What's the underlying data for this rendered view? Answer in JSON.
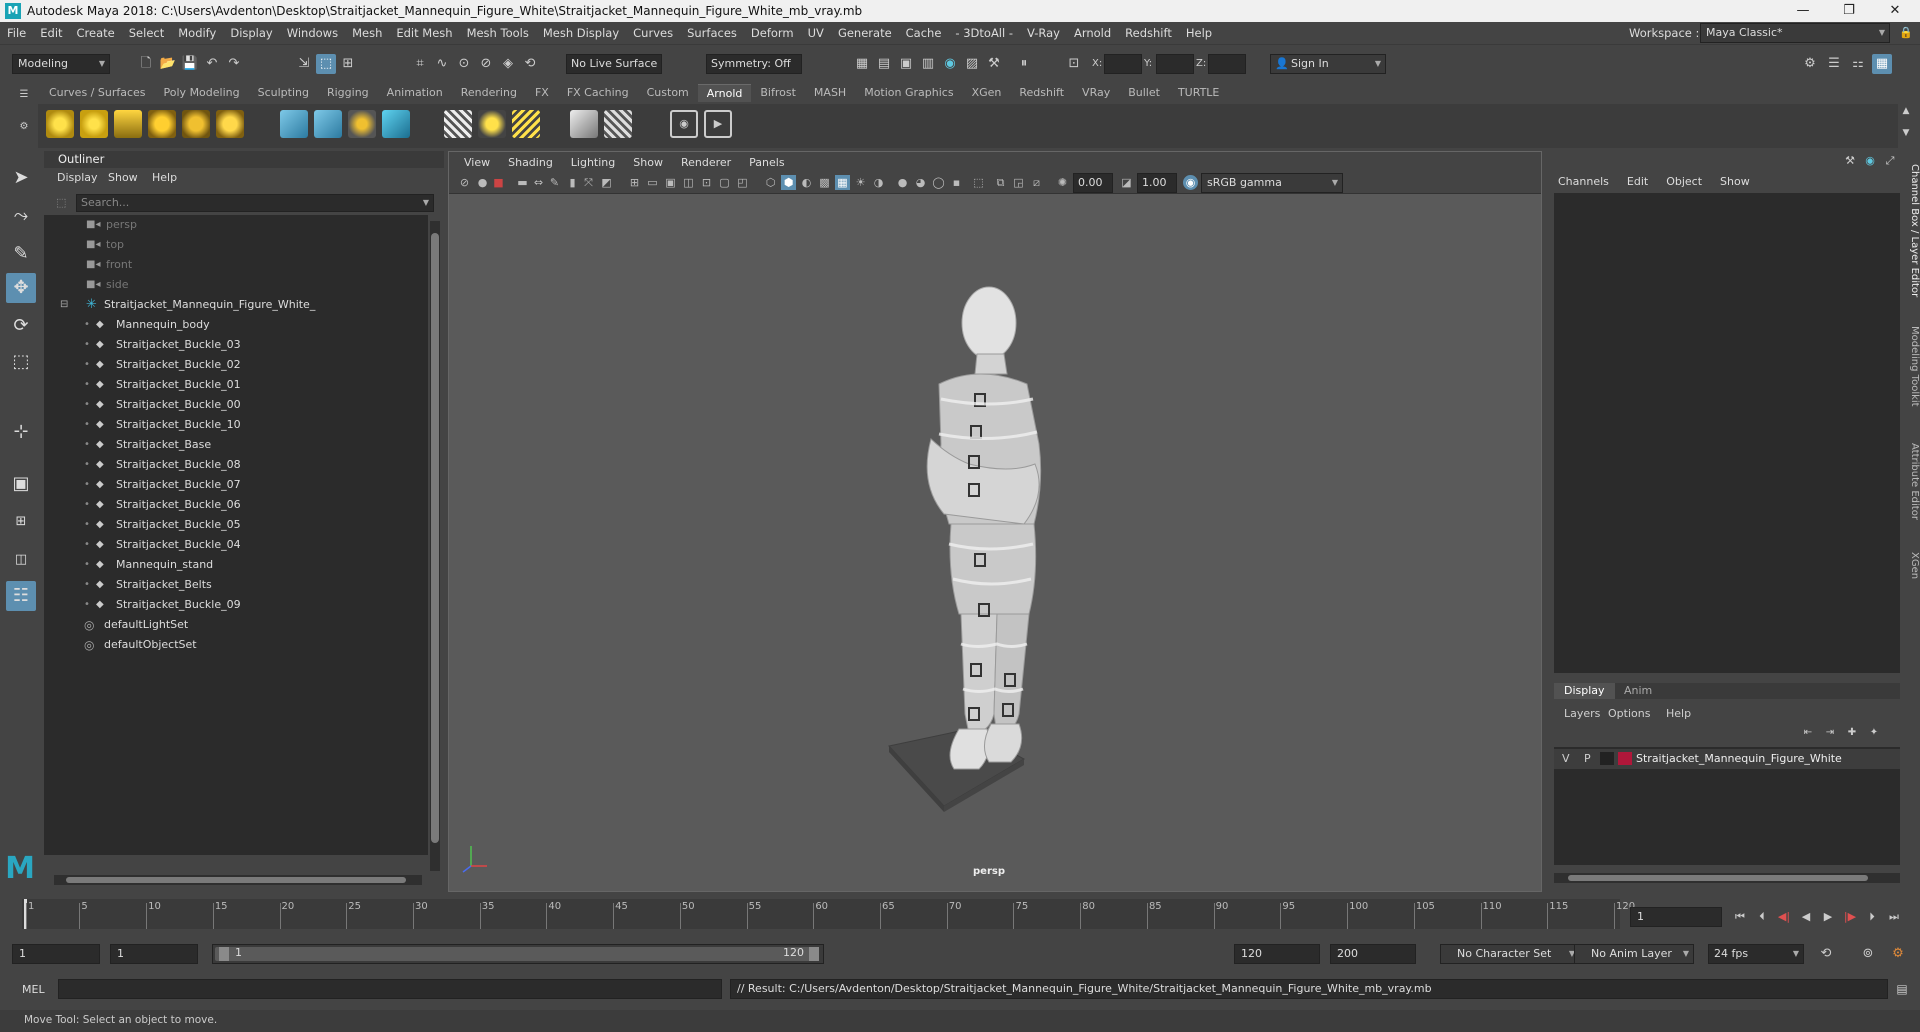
{
  "window": {
    "title": "Autodesk Maya 2018: C:\\Users\\Avdenton\\Desktop\\Straitjacket_Mannequin_Figure_White\\Straitjacket_Mannequin_Figure_White_mb_vray.mb",
    "logo": "M"
  },
  "menu": [
    "File",
    "Edit",
    "Create",
    "Select",
    "Modify",
    "Display",
    "Windows",
    "Mesh",
    "Edit Mesh",
    "Mesh Tools",
    "Mesh Display",
    "Curves",
    "Surfaces",
    "Deform",
    "UV",
    "Generate",
    "Cache",
    "- 3DtoAll -",
    "V-Ray",
    "Arnold",
    "Redshift",
    "Help"
  ],
  "workspace": {
    "label": "Workspace :",
    "value": "Maya Classic*"
  },
  "status": {
    "mode": "Modeling",
    "live_surface": "No Live Surface",
    "symmetry": "Symmetry: Off",
    "x_label": "X:",
    "y_label": "Y:",
    "z_label": "Z:",
    "sign_in": "Sign In"
  },
  "shelf_tabs": [
    "Curves / Surfaces",
    "Poly Modeling",
    "Sculpting",
    "Rigging",
    "Animation",
    "Rendering",
    "FX",
    "FX Caching",
    "Custom",
    "Arnold",
    "Bifrost",
    "MASH",
    "Motion Graphics",
    "XGen",
    "Redshift",
    "VRay",
    "Bullet",
    "TURTLE"
  ],
  "shelf_active": "Arnold",
  "outliner": {
    "title": "Outliner",
    "menu": [
      "Display",
      "Show",
      "Help"
    ],
    "search_placeholder": "Search...",
    "cameras": [
      "persp",
      "top",
      "front",
      "side"
    ],
    "group": "Straitjacket_Mannequin_Figure_White_",
    "children": [
      "Mannequin_body",
      "Straitjacket_Buckle_03",
      "Straitjacket_Buckle_02",
      "Straitjacket_Buckle_01",
      "Straitjacket_Buckle_00",
      "Straitjacket_Buckle_10",
      "Straitjacket_Base",
      "Straitjacket_Buckle_08",
      "Straitjacket_Buckle_07",
      "Straitjacket_Buckle_06",
      "Straitjacket_Buckle_05",
      "Straitjacket_Buckle_04",
      "Mannequin_stand",
      "Straitjacket_Belts",
      "Straitjacket_Buckle_09"
    ],
    "sets": [
      "defaultLightSet",
      "defaultObjectSet"
    ]
  },
  "viewport": {
    "menu": [
      "View",
      "Shading",
      "Lighting",
      "Show",
      "Renderer",
      "Panels"
    ],
    "exposure": "0.00",
    "gamma": "1.00",
    "colorspace": "sRGB gamma",
    "camera_label": "persp"
  },
  "channelbox": {
    "menu": [
      "Channels",
      "Edit",
      "Object",
      "Show"
    ],
    "tabs": [
      "Display",
      "Anim"
    ],
    "layer_menu": [
      "Layers",
      "Options",
      "Help"
    ],
    "layer": {
      "v": "V",
      "p": "P",
      "name": "Straitjacket_Mannequin_Figure_White",
      "color": "#b0173a"
    }
  },
  "side_tabs": [
    "Channel Box / Layer Editor",
    "Modeling Toolkit",
    "Attribute Editor",
    "XGen"
  ],
  "timeline": {
    "ticks": [
      "1",
      "5",
      "10",
      "15",
      "20",
      "25",
      "30",
      "35",
      "40",
      "45",
      "50",
      "55",
      "60",
      "65",
      "70",
      "75",
      "80",
      "85",
      "90",
      "95",
      "100",
      "105",
      "110",
      "115",
      "120"
    ],
    "current_frame": "1"
  },
  "range": {
    "start": "1",
    "anim_start": "1",
    "slider_start": "1",
    "slider_end": "120",
    "end": "120",
    "anim_end": "200",
    "character_set": "No Character Set",
    "anim_layer": "No Anim Layer",
    "fps": "24 fps"
  },
  "command": {
    "lang": "MEL",
    "result": "// Result: C:/Users/Avdenton/Desktop/Straitjacket_Mannequin_Figure_White/Straitjacket_Mannequin_Figure_White_mb_vray.mb"
  },
  "help_line": "Move Tool: Select an object to move.",
  "colors": {
    "accent": "#5d8fb0",
    "panel": "#444444",
    "field": "#2b2b2b",
    "viewport": "#5a5a5a"
  }
}
